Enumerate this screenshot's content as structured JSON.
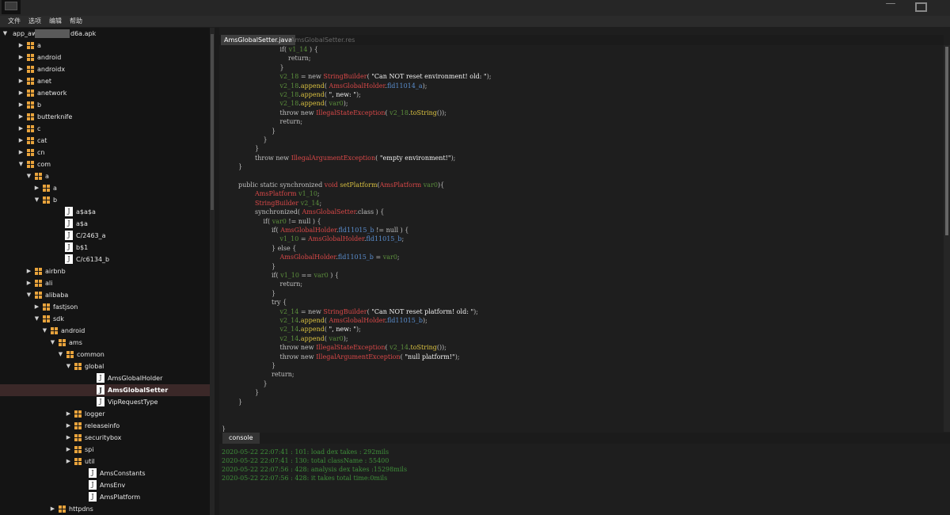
{
  "menu": [
    "文件",
    "选项",
    "编辑",
    "帮助"
  ],
  "tree": [
    {
      "label": "app_aw",
      "label2": "d6a.apk",
      "depth": 0,
      "type": "root",
      "arrow": "down"
    },
    {
      "label": "a",
      "depth": 1,
      "type": "folder",
      "arrow": "right"
    },
    {
      "label": "android",
      "depth": 1,
      "type": "folder",
      "arrow": "right"
    },
    {
      "label": "androidx",
      "depth": 1,
      "type": "folder",
      "arrow": "right"
    },
    {
      "label": "anet",
      "depth": 1,
      "type": "folder",
      "arrow": "right"
    },
    {
      "label": "anetwork",
      "depth": 1,
      "type": "folder",
      "arrow": "right"
    },
    {
      "label": "b",
      "depth": 1,
      "type": "folder",
      "arrow": "right"
    },
    {
      "label": "butterknife",
      "depth": 1,
      "type": "folder",
      "arrow": "right"
    },
    {
      "label": "c",
      "depth": 1,
      "type": "folder",
      "arrow": "right"
    },
    {
      "label": "cat",
      "depth": 1,
      "type": "folder",
      "arrow": "right"
    },
    {
      "label": "cn",
      "depth": 1,
      "type": "folder",
      "arrow": "right"
    },
    {
      "label": "com",
      "depth": 1,
      "type": "folder",
      "arrow": "down"
    },
    {
      "label": "a",
      "depth": 2,
      "type": "folder",
      "arrow": "down"
    },
    {
      "label": "a",
      "depth": 3,
      "type": "folder",
      "arrow": "right"
    },
    {
      "label": "b",
      "depth": 3,
      "type": "folder",
      "arrow": "down"
    },
    {
      "label": "a$a$a",
      "depth": 4,
      "type": "file"
    },
    {
      "label": "a$a",
      "depth": 4,
      "type": "file"
    },
    {
      "label": "C/2463_a",
      "depth": 4,
      "type": "file"
    },
    {
      "label": "b$1",
      "depth": 4,
      "type": "file"
    },
    {
      "label": "C/c6134_b",
      "depth": 4,
      "type": "file"
    },
    {
      "label": "airbnb",
      "depth": 2,
      "type": "folder",
      "arrow": "right"
    },
    {
      "label": "ali",
      "depth": 2,
      "type": "folder",
      "arrow": "right"
    },
    {
      "label": "alibaba",
      "depth": 2,
      "type": "folder",
      "arrow": "down"
    },
    {
      "label": "fastjson",
      "depth": 3,
      "type": "folder",
      "arrow": "right"
    },
    {
      "label": "sdk",
      "depth": 3,
      "type": "folder",
      "arrow": "down"
    },
    {
      "label": "android",
      "depth": 4,
      "type": "folder",
      "arrow": "down"
    },
    {
      "label": "ams",
      "depth": 5,
      "type": "folder",
      "arrow": "down"
    },
    {
      "label": "common",
      "depth": 6,
      "type": "folder",
      "arrow": "down"
    },
    {
      "label": "global",
      "depth": 7,
      "type": "folder",
      "arrow": "down"
    },
    {
      "label": "AmsGlobalHolder",
      "depth": 8,
      "type": "file"
    },
    {
      "label": "AmsGlobalSetter",
      "depth": 8,
      "type": "file",
      "selected": true
    },
    {
      "label": "VipRequestType",
      "depth": 8,
      "type": "file"
    },
    {
      "label": "logger",
      "depth": 7,
      "type": "folder",
      "arrow": "right"
    },
    {
      "label": "releaseinfo",
      "depth": 7,
      "type": "folder",
      "arrow": "right"
    },
    {
      "label": "securitybox",
      "depth": 7,
      "type": "folder",
      "arrow": "right"
    },
    {
      "label": "spi",
      "depth": 7,
      "type": "folder",
      "arrow": "right"
    },
    {
      "label": "util",
      "depth": 7,
      "type": "folder",
      "arrow": "right"
    },
    {
      "label": "AmsConstants",
      "depth": 7,
      "type": "file"
    },
    {
      "label": "AmsEnv",
      "depth": 7,
      "type": "file"
    },
    {
      "label": "AmsPlatform",
      "depth": 7,
      "type": "file"
    },
    {
      "label": "httpdns",
      "depth": 5,
      "type": "folder",
      "arrow": "right"
    }
  ],
  "tabs": {
    "active": "AmsGlobalSetter.java",
    "inactive": "AmsGlobalSetter.res"
  },
  "code": [
    {
      "indent": 7,
      "segs": [
        [
          "kw",
          "if( "
        ],
        [
          "var",
          "v1_14"
        ],
        [
          "kw",
          " ) {"
        ]
      ]
    },
    {
      "indent": 8,
      "segs": [
        [
          "kw",
          "return;"
        ]
      ]
    },
    {
      "indent": 7,
      "segs": [
        [
          "kw",
          "}"
        ]
      ]
    },
    {
      "indent": 7,
      "segs": [
        [
          "var",
          "v2_18"
        ],
        [
          "kw",
          " = new "
        ],
        [
          "cls",
          "StringBuilder"
        ],
        [
          "kw",
          "( "
        ],
        [
          "str",
          "\"Can NOT reset environment! old: \""
        ],
        [
          "kw",
          ");"
        ]
      ]
    },
    {
      "indent": 7,
      "segs": [
        [
          "var",
          "v2_18"
        ],
        [
          "kw",
          "."
        ],
        [
          "mth",
          "append"
        ],
        [
          "kw",
          "( "
        ],
        [
          "cls",
          "AmsGlobalHolder"
        ],
        [
          "kw",
          "."
        ],
        [
          "fld",
          "fld11014_a"
        ],
        [
          "kw",
          ");"
        ]
      ]
    },
    {
      "indent": 7,
      "segs": [
        [
          "var",
          "v2_18"
        ],
        [
          "kw",
          "."
        ],
        [
          "mth",
          "append"
        ],
        [
          "kw",
          "( "
        ],
        [
          "str",
          "\", new: \""
        ],
        [
          "kw",
          ");"
        ]
      ]
    },
    {
      "indent": 7,
      "segs": [
        [
          "var",
          "v2_18"
        ],
        [
          "kw",
          "."
        ],
        [
          "mth",
          "append"
        ],
        [
          "kw",
          "( "
        ],
        [
          "var",
          "var0"
        ],
        [
          "kw",
          ");"
        ]
      ]
    },
    {
      "indent": 7,
      "segs": [
        [
          "kw",
          "throw new "
        ],
        [
          "cls",
          "IllegalStateException"
        ],
        [
          "kw",
          "( "
        ],
        [
          "var",
          "v2_18"
        ],
        [
          "kw",
          "."
        ],
        [
          "mth",
          "toString"
        ],
        [
          "kw",
          "());"
        ]
      ]
    },
    {
      "indent": 7,
      "segs": [
        [
          "kw",
          "return;"
        ]
      ]
    },
    {
      "indent": 6,
      "segs": [
        [
          "kw",
          "}"
        ]
      ]
    },
    {
      "indent": 5,
      "segs": [
        [
          "kw",
          "}"
        ]
      ]
    },
    {
      "indent": 4,
      "segs": [
        [
          "kw",
          "}"
        ]
      ]
    },
    {
      "indent": 4,
      "segs": [
        [
          "kw",
          "throw new "
        ],
        [
          "cls",
          "IllegalArgumentException"
        ],
        [
          "kw",
          "( "
        ],
        [
          "str",
          "\"empty environment!\""
        ],
        [
          "kw",
          ");"
        ]
      ]
    },
    {
      "indent": 2,
      "segs": [
        [
          "kw",
          "}"
        ]
      ]
    },
    {
      "indent": 0,
      "segs": []
    },
    {
      "indent": 2,
      "segs": [
        [
          "kw",
          "public static synchronized "
        ],
        [
          "cls",
          "void "
        ],
        [
          "mth",
          "setPlatform"
        ],
        [
          "kw",
          "("
        ],
        [
          "cls",
          "AmsPlatform "
        ],
        [
          "var",
          "var0"
        ],
        [
          "kw",
          "){"
        ]
      ]
    },
    {
      "indent": 4,
      "segs": [
        [
          "cls",
          "AmsPlatform "
        ],
        [
          "var",
          "v1_10"
        ],
        [
          "kw",
          ";"
        ]
      ]
    },
    {
      "indent": 4,
      "segs": [
        [
          "cls",
          "StringBuilder "
        ],
        [
          "var",
          "v2_14"
        ],
        [
          "kw",
          ";"
        ]
      ]
    },
    {
      "indent": 4,
      "segs": [
        [
          "kw",
          "synchronized( "
        ],
        [
          "cls",
          "AmsGlobalSetter"
        ],
        [
          "kw",
          ".class ) {"
        ]
      ]
    },
    {
      "indent": 5,
      "segs": [
        [
          "kw",
          "if( "
        ],
        [
          "var",
          "var0"
        ],
        [
          "kw",
          " != null ) {"
        ]
      ]
    },
    {
      "indent": 6,
      "segs": [
        [
          "kw",
          "if( "
        ],
        [
          "cls",
          "AmsGlobalHolder"
        ],
        [
          "kw",
          "."
        ],
        [
          "fld",
          "fld11015_b"
        ],
        [
          "kw",
          " != null ) {"
        ]
      ]
    },
    {
      "indent": 7,
      "segs": [
        [
          "var",
          "v1_10"
        ],
        [
          "kw",
          " = "
        ],
        [
          "cls",
          "AmsGlobalHolder"
        ],
        [
          "kw",
          "."
        ],
        [
          "fld",
          "fld11015_b"
        ],
        [
          "kw",
          ";"
        ]
      ]
    },
    {
      "indent": 6,
      "segs": [
        [
          "kw",
          "} else {"
        ]
      ]
    },
    {
      "indent": 7,
      "segs": [
        [
          "cls",
          "AmsGlobalHolder"
        ],
        [
          "kw",
          "."
        ],
        [
          "fld",
          "fld11015_b"
        ],
        [
          "kw",
          " = "
        ],
        [
          "var",
          "var0"
        ],
        [
          "kw",
          ";"
        ]
      ]
    },
    {
      "indent": 6,
      "segs": [
        [
          "kw",
          "}"
        ]
      ]
    },
    {
      "indent": 6,
      "segs": [
        [
          "kw",
          "if( "
        ],
        [
          "var",
          "v1_10"
        ],
        [
          "kw",
          " == "
        ],
        [
          "var",
          "var0"
        ],
        [
          "kw",
          " ) {"
        ]
      ]
    },
    {
      "indent": 7,
      "segs": [
        [
          "kw",
          "return;"
        ]
      ]
    },
    {
      "indent": 6,
      "segs": [
        [
          "kw",
          "}"
        ]
      ]
    },
    {
      "indent": 6,
      "segs": [
        [
          "kw",
          "try {"
        ]
      ]
    },
    {
      "indent": 7,
      "segs": [
        [
          "var",
          "v2_14"
        ],
        [
          "kw",
          " = new "
        ],
        [
          "cls",
          "StringBuilder"
        ],
        [
          "kw",
          "( "
        ],
        [
          "str",
          "\"Can NOT reset platform! old: \""
        ],
        [
          "kw",
          ");"
        ]
      ]
    },
    {
      "indent": 7,
      "segs": [
        [
          "var",
          "v2_14"
        ],
        [
          "kw",
          "."
        ],
        [
          "mth",
          "append"
        ],
        [
          "kw",
          "( "
        ],
        [
          "cls",
          "AmsGlobalHolder"
        ],
        [
          "kw",
          "."
        ],
        [
          "fld",
          "fld11015_b"
        ],
        [
          "kw",
          ");"
        ]
      ]
    },
    {
      "indent": 7,
      "segs": [
        [
          "var",
          "v2_14"
        ],
        [
          "kw",
          "."
        ],
        [
          "mth",
          "append"
        ],
        [
          "kw",
          "( "
        ],
        [
          "str",
          "\", new: \""
        ],
        [
          "kw",
          ");"
        ]
      ]
    },
    {
      "indent": 7,
      "segs": [
        [
          "var",
          "v2_14"
        ],
        [
          "kw",
          "."
        ],
        [
          "mth",
          "append"
        ],
        [
          "kw",
          "( "
        ],
        [
          "var",
          "var0"
        ],
        [
          "kw",
          ");"
        ]
      ]
    },
    {
      "indent": 7,
      "segs": [
        [
          "kw",
          "throw new "
        ],
        [
          "cls",
          "IllegalStateException"
        ],
        [
          "kw",
          "( "
        ],
        [
          "var",
          "v2_14"
        ],
        [
          "kw",
          "."
        ],
        [
          "mth",
          "toString"
        ],
        [
          "kw",
          "());"
        ]
      ]
    },
    {
      "indent": 7,
      "segs": [
        [
          "kw",
          "throw new "
        ],
        [
          "cls",
          "IllegalArgumentException"
        ],
        [
          "kw",
          "( "
        ],
        [
          "str",
          "\"null platform!\""
        ],
        [
          "kw",
          ");"
        ]
      ]
    },
    {
      "indent": 6,
      "segs": [
        [
          "kw",
          "}"
        ]
      ]
    },
    {
      "indent": 6,
      "segs": [
        [
          "kw",
          "return;"
        ]
      ]
    },
    {
      "indent": 5,
      "segs": [
        [
          "kw",
          "}"
        ]
      ]
    },
    {
      "indent": 4,
      "segs": [
        [
          "kw",
          "}"
        ]
      ]
    },
    {
      "indent": 2,
      "segs": [
        [
          "kw",
          "}"
        ]
      ]
    },
    {
      "indent": 0,
      "segs": []
    },
    {
      "indent": 0,
      "segs": []
    },
    {
      "indent": 0,
      "segs": [
        [
          "kw",
          "}"
        ]
      ]
    }
  ],
  "console": {
    "tab": "console",
    "lines": [
      "2020-05-22 22:07:41 : 101: load dex takes : 292mils",
      "2020-05-22 22:07:41 : 130: total className : 55400",
      "2020-05-22 22:07:56 : 428: analysis dex takes :15298mils",
      "2020-05-22 22:07:56 : 428: it takes total time:0mils"
    ]
  },
  "colors": {
    "accent": "#e8a33c",
    "selected_row": "#3b2828",
    "console_text": "#3f8f3a"
  }
}
